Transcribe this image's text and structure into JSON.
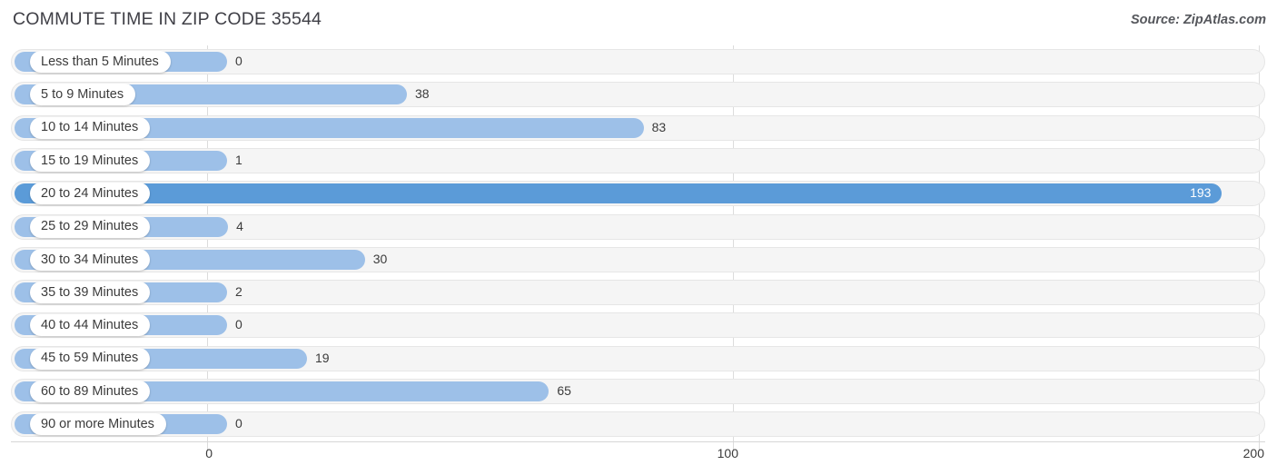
{
  "header": {
    "title": "COMMUTE TIME IN ZIP CODE 35544",
    "source": "Source: ZipAtlas.com"
  },
  "colors": {
    "bar": "#9dc0e8",
    "bar_highlight": "#5b9bd8",
    "track": "#f5f5f5",
    "gridline": "#dcdcdc",
    "text": "#3b3b3b"
  },
  "chart_data": {
    "type": "bar",
    "orientation": "horizontal",
    "title": "COMMUTE TIME IN ZIP CODE 35544",
    "xlabel": "",
    "ylabel": "",
    "xlim": [
      0,
      200
    ],
    "xticks": [
      0,
      100,
      200
    ],
    "xtick_labels": [
      "0",
      "100",
      "200"
    ],
    "grid": true,
    "legend": false,
    "categories": [
      "Less than 5 Minutes",
      "5 to 9 Minutes",
      "10 to 14 Minutes",
      "15 to 19 Minutes",
      "20 to 24 Minutes",
      "25 to 29 Minutes",
      "30 to 34 Minutes",
      "35 to 39 Minutes",
      "40 to 44 Minutes",
      "45 to 59 Minutes",
      "60 to 89 Minutes",
      "90 or more Minutes"
    ],
    "values": [
      0,
      38,
      83,
      1,
      193,
      4,
      30,
      2,
      0,
      19,
      65,
      0
    ],
    "value_labels": [
      "0",
      "38",
      "83",
      "1",
      "193",
      "4",
      "30",
      "2",
      "0",
      "19",
      "65",
      "0"
    ],
    "highlight_index": 4,
    "rows": [
      {
        "label": "Less than 5 Minutes",
        "value": 0,
        "value_label": "0",
        "highlight": false
      },
      {
        "label": "5 to 9 Minutes",
        "value": 38,
        "value_label": "38",
        "highlight": false
      },
      {
        "label": "10 to 14 Minutes",
        "value": 83,
        "value_label": "83",
        "highlight": false
      },
      {
        "label": "15 to 19 Minutes",
        "value": 1,
        "value_label": "1",
        "highlight": false
      },
      {
        "label": "20 to 24 Minutes",
        "value": 193,
        "value_label": "193",
        "highlight": true
      },
      {
        "label": "25 to 29 Minutes",
        "value": 4,
        "value_label": "4",
        "highlight": false
      },
      {
        "label": "30 to 34 Minutes",
        "value": 30,
        "value_label": "30",
        "highlight": false
      },
      {
        "label": "35 to 39 Minutes",
        "value": 2,
        "value_label": "2",
        "highlight": false
      },
      {
        "label": "40 to 44 Minutes",
        "value": 0,
        "value_label": "0",
        "highlight": false
      },
      {
        "label": "45 to 59 Minutes",
        "value": 19,
        "value_label": "19",
        "highlight": false
      },
      {
        "label": "60 to 89 Minutes",
        "value": 65,
        "value_label": "65",
        "highlight": false
      },
      {
        "label": "90 or more Minutes",
        "value": 0,
        "value_label": "0",
        "highlight": false
      }
    ]
  }
}
